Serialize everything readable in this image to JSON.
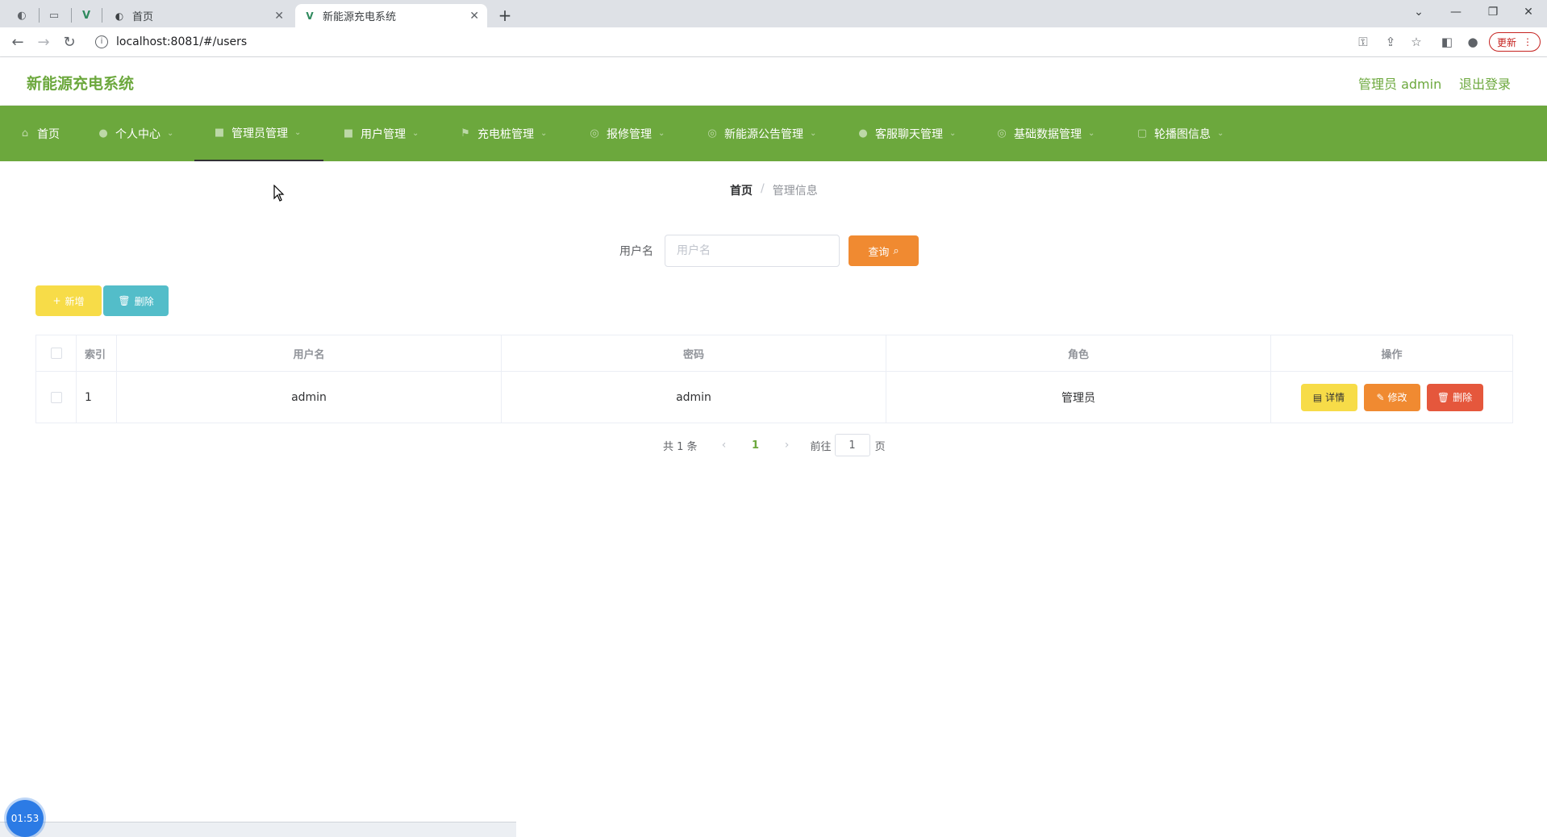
{
  "browser": {
    "tabs": [
      {
        "title": "首页",
        "active": false
      },
      {
        "title": "新能源充电系统",
        "active": true
      }
    ],
    "url": "localhost:8081/#/users",
    "update_label": "更新"
  },
  "header": {
    "title": "新能源充电系统",
    "user_label": "管理员 admin",
    "logout_label": "退出登录"
  },
  "menu": [
    {
      "label": "首页",
      "icon": "home-icon"
    },
    {
      "label": "个人中心",
      "icon": "user-icon"
    },
    {
      "label": "管理员管理",
      "icon": "admin-icon",
      "active": true
    },
    {
      "label": "用户管理",
      "icon": "users-icon"
    },
    {
      "label": "充电桩管理",
      "icon": "flag-icon"
    },
    {
      "label": "报修管理",
      "icon": "repair-icon"
    },
    {
      "label": "新能源公告管理",
      "icon": "notice-icon"
    },
    {
      "label": "客服聊天管理",
      "icon": "chat-icon"
    },
    {
      "label": "基础数据管理",
      "icon": "data-icon"
    },
    {
      "label": "轮播图信息",
      "icon": "carousel-icon"
    }
  ],
  "breadcrumb": {
    "home": "首页",
    "current": "管理信息"
  },
  "search": {
    "label": "用户名",
    "placeholder": "用户名",
    "value": "",
    "button_label": "查询"
  },
  "actions": {
    "add_label": "新增",
    "delete_label": "删除"
  },
  "table": {
    "columns": [
      "索引",
      "用户名",
      "密码",
      "角色",
      "操作"
    ],
    "rows": [
      {
        "index": "1",
        "username": "admin",
        "password": "admin",
        "role": "管理员"
      }
    ],
    "row_actions": {
      "detail": "详情",
      "edit": "修改",
      "delete": "删除"
    }
  },
  "pagination": {
    "total_text": "共 1 条",
    "current_page": "1",
    "goto_label": "前往",
    "goto_value": "1",
    "page_suffix": "页"
  },
  "overlay": {
    "clock": "01:53"
  },
  "colors": {
    "brand_green": "#6ca83d",
    "query_orange": "#f08a31",
    "add_yellow": "#f7dc48",
    "delete_teal": "#53bdc9",
    "row_delete_red": "#e5573c"
  }
}
